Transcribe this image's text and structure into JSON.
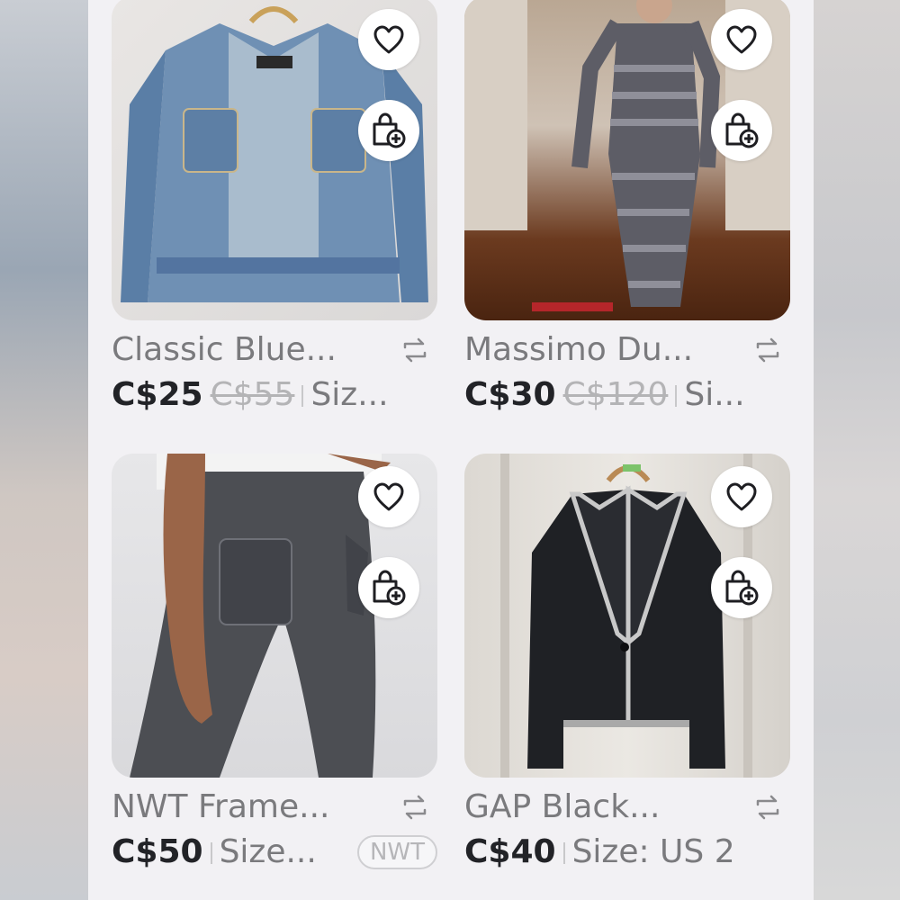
{
  "listings": [
    {
      "title": "Classic Blue...",
      "price": "C$25",
      "original_price": "C$55",
      "size": "Siz...",
      "image_alt": "denim jacket",
      "liked": false
    },
    {
      "title": "Massimo Du...",
      "price": "C$30",
      "original_price": "C$120",
      "size": "Si...",
      "image_alt": "striped dress",
      "liked": false
    },
    {
      "title": "NWT Frame...",
      "price": "C$50",
      "size": "Size...",
      "badge": "NWT",
      "image_alt": "black jeans",
      "liked": false
    },
    {
      "title": "GAP Black...",
      "price": "C$40",
      "size": "Size: US 2",
      "image_alt": "black blazer",
      "liked": false
    }
  ],
  "icons": {
    "like": "heart-icon",
    "add_to_bundle": "bag-plus-icon",
    "repost": "repost-icon"
  },
  "colors": {
    "price": "#222327",
    "title": "#7a7a7d",
    "original_price": "#b4b4b6",
    "background": "#f2f1f4"
  }
}
